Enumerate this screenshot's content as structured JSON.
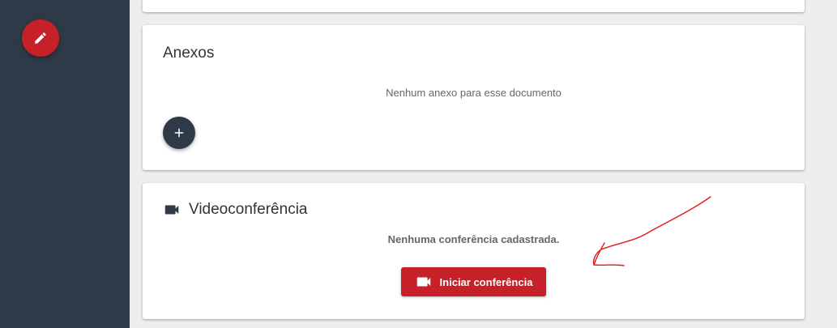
{
  "sidebar": {
    "edit_fab_icon": "pencil-icon",
    "fab_color": "#c62128",
    "background": "#2e3a47"
  },
  "attachments": {
    "title": "Anexos",
    "empty_message": "Nenhum anexo para esse documento",
    "add_icon": "plus-icon"
  },
  "videoconference": {
    "icon": "videocam-icon",
    "title": "Videoconferência",
    "empty_message": "Nenhuma conferência cadastrada.",
    "start_button_label": "Iniciar conferência",
    "start_button_icon": "videocam-icon",
    "accent": "#c62128"
  },
  "annotation": {
    "type": "hand-drawn-arrow",
    "color": "#e01b1b"
  }
}
